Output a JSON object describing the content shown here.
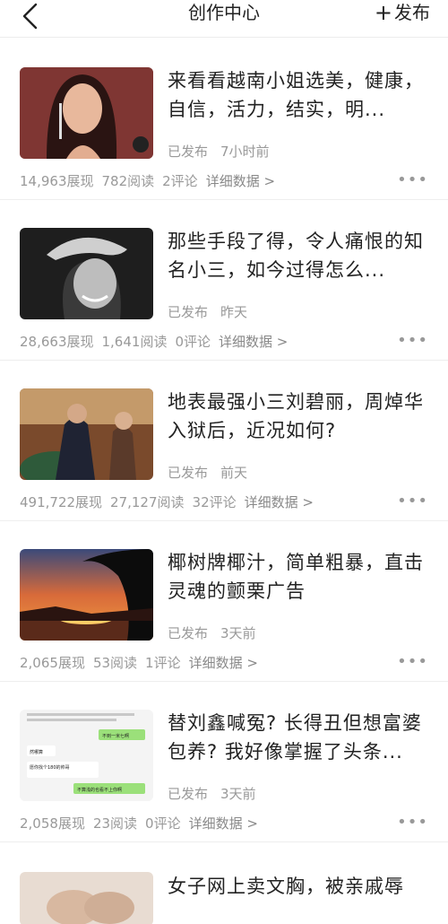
{
  "header": {
    "title": "创作中心",
    "publish_label": "发布"
  },
  "articles": [
    {
      "headline": "来看看越南小姐选美，健康，自信，活力，结实，明...",
      "status": "已发布",
      "time": "7小时前",
      "views": "14,963展现",
      "reads": "782阅读",
      "comments": "2评论",
      "detail": "详细数据 >",
      "thumb_icon": "portrait-photo"
    },
    {
      "headline": "那些手段了得，令人痛恨的知名小三，如今过得怎么...",
      "status": "已发布",
      "time": "昨天",
      "views": "28,663展现",
      "reads": "1,641阅读",
      "comments": "0评论",
      "detail": "详细数据 >",
      "thumb_icon": "bw-portrait-photo"
    },
    {
      "headline": "地表最强小三刘碧丽，周焯华入狱后，近况如何?",
      "status": "已发布",
      "time": "前天",
      "views": "491,722展现",
      "reads": "27,127阅读",
      "comments": "32评论",
      "detail": "详细数据 >",
      "thumb_icon": "casino-photo"
    },
    {
      "headline": "椰树牌椰汁，简单粗暴，直击灵魂的颤栗广告",
      "status": "已发布",
      "time": "3天前",
      "views": "2,065展现",
      "reads": "53阅读",
      "comments": "1评论",
      "detail": "详细数据 >",
      "thumb_icon": "sunset-palm-photo"
    },
    {
      "headline": "替刘鑫喊冤? 长得丑但想富婆包养? 我好像掌握了头条...",
      "status": "已发布",
      "time": "3天前",
      "views": "2,058展现",
      "reads": "23阅读",
      "comments": "0评论",
      "detail": "详细数据 >",
      "thumb_icon": "chat-screenshot",
      "chat": [
        "不到一米七啊",
        "然哪算",
        "愿你找个180的帅哥 传遍你的名 赢",
        "不算浅的也看不上你啊"
      ]
    }
  ],
  "partial_article": {
    "headline": "女子网上卖文胸，被亲戚辱"
  },
  "more_label": "•••",
  "colors": {
    "text": "#222222",
    "meta": "#999999",
    "divider": "#eeeeee"
  }
}
